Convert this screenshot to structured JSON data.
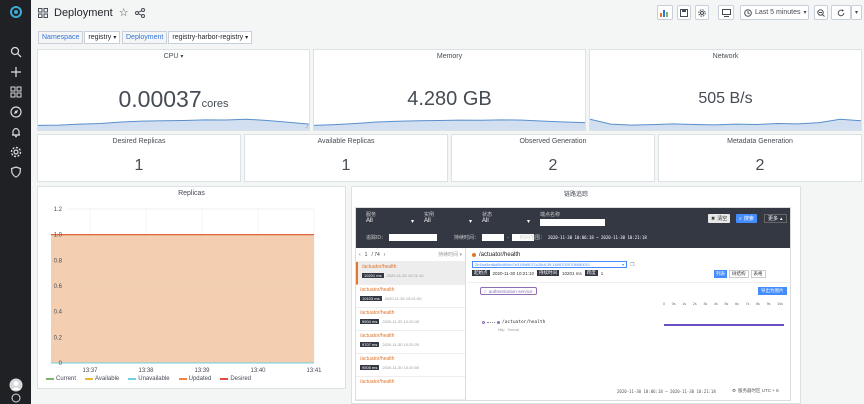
{
  "dashboard": {
    "title": "Deployment"
  },
  "toolbar": {
    "time_range": "Last 5 minutes"
  },
  "variables": [
    {
      "label": "Namespace",
      "value": "registry"
    },
    {
      "label": "Deployment",
      "value": "registry-harbor-registry"
    }
  ],
  "stats": {
    "cpu": {
      "title": "CPU",
      "value": "0.00037",
      "unit": "cores",
      "spark": [
        0.3,
        0.32,
        0.38,
        0.42,
        0.52,
        0.58,
        0.6,
        0.62,
        0.66,
        0.65,
        0.7,
        0.62,
        0.5,
        0.38
      ]
    },
    "memory": {
      "title": "Memory",
      "value": "4.280 GB",
      "spark": [
        0.3,
        0.35,
        0.42,
        0.52,
        0.57,
        0.6,
        0.62,
        0.64,
        0.63,
        0.66,
        0.64,
        0.58,
        0.52,
        0.48
      ]
    },
    "network": {
      "title": "Network",
      "value": "505 B/s",
      "spark": [
        0.7,
        0.38,
        0.32,
        0.35,
        0.4,
        0.36,
        0.33,
        0.38,
        0.36,
        0.42,
        0.4,
        0.48,
        0.7,
        0.6
      ]
    },
    "desired": {
      "title": "Desired Replicas",
      "value": "1"
    },
    "available": {
      "title": "Available Replicas",
      "value": "1"
    },
    "observed": {
      "title": "Observed Generation",
      "value": "2"
    },
    "metadata": {
      "title": "Metadata Generation",
      "value": "2"
    }
  },
  "replicas_panel": {
    "title": "Replicas"
  },
  "chart_data": {
    "type": "area",
    "title": "Replicas",
    "x": [
      "13:37",
      "13:38",
      "13:39",
      "13:40",
      "13:41"
    ],
    "ylim": [
      0,
      1.2
    ],
    "yticks": [
      "0",
      "0.2",
      "0.4",
      "0.6",
      "0.8",
      "1.0",
      "1.2"
    ],
    "series": [
      {
        "name": "Current",
        "color": "#7eb26d",
        "values": [
          1,
          1,
          1,
          1,
          1
        ]
      },
      {
        "name": "Available",
        "color": "#eab839",
        "values": [
          1,
          1,
          1,
          1,
          1
        ]
      },
      {
        "name": "Unavailable",
        "color": "#6ed0e0",
        "values": [
          0,
          0,
          0,
          0,
          0
        ]
      },
      {
        "name": "Updated",
        "color": "#ef843c",
        "values": [
          1,
          1,
          1,
          1,
          1
        ]
      },
      {
        "name": "Desired",
        "color": "#e24d42",
        "values": [
          1,
          1,
          1,
          1,
          1
        ]
      }
    ]
  },
  "trace_panel": {
    "title": "链路追踪",
    "filters": [
      {
        "label": "服务",
        "value": "All"
      },
      {
        "label": "实例",
        "value": "All"
      },
      {
        "label": "状态",
        "value": "All"
      },
      {
        "label": "端点名称",
        "value": ""
      }
    ],
    "trace_id_label": "追踪ID：",
    "duration_label": "持续时间：",
    "time_range_label": "时间范围：",
    "time_range_value": "2020-11-30 10:06:18 ~ 2020-11-30 10:21:18",
    "clear_button": "清空",
    "search_button": "搜索",
    "more_button": "更多",
    "pagination": {
      "current": "1",
      "total": "/ 74",
      "sort": "持续时间"
    },
    "list": [
      {
        "endpoint": "/actuator/health",
        "duration": "10201 ms",
        "time": "2020-11-30 10:21:10"
      },
      {
        "endpoint": "/actuator/health",
        "duration": "10103 ms",
        "time": "2020-11-30 10:21:00"
      },
      {
        "endpoint": "/actuator/health",
        "duration": "9904 ms",
        "time": "2020-11-30 10:20:40"
      },
      {
        "endpoint": "/actuator/health",
        "duration": "9707 ms",
        "time": "2020-11-30 10:20:20"
      },
      {
        "endpoint": "/actuator/health",
        "duration": "9505 ms",
        "time": "2020-11-30 10:20:00"
      },
      {
        "endpoint": "/actuator/health",
        "duration": "",
        "time": ""
      }
    ],
    "detail": {
      "endpoint": "/actuator/health",
      "trace_id": "2b1bd4ed6d8b469cb7e31f5d9071c26df.39.16067020706080011",
      "start_label": "起始点",
      "start_value": "2020-11-30 10:21:10",
      "duration_label": "持续时间",
      "duration_value": "10201 ms",
      "span_label": "跨度",
      "span_value": "1",
      "view_list": "列表",
      "view_tree": "树结构",
      "view_table": "表格",
      "service_tag": "authentication-service",
      "export_button": "导出为图片",
      "span_name": "/actuator/health",
      "span_sub": "Http · Tomcat",
      "scale": [
        "0",
        "0s",
        "1s",
        "2s",
        "3s",
        "4s",
        "5s",
        "6s",
        "7s",
        "8s",
        "9s",
        "10s"
      ],
      "footer_range": "2020-11-30 10:06:18 ~ 2020-11-30 10:21:18",
      "timezone": "服务器时区 UTC + 8"
    }
  }
}
